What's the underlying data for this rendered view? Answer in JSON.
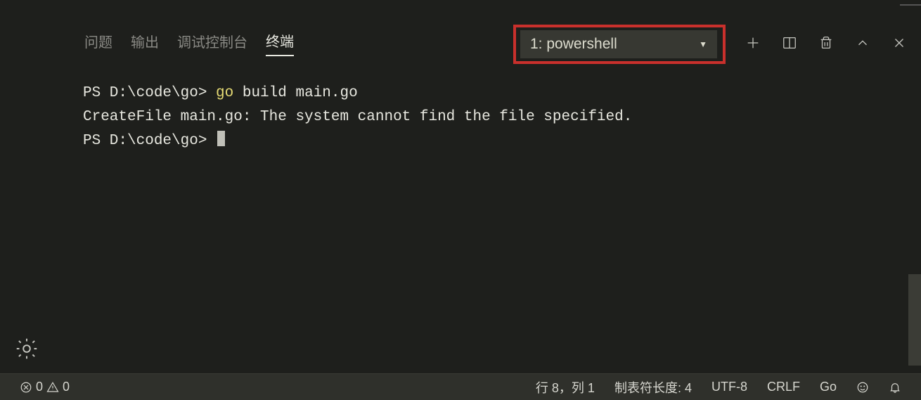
{
  "panel": {
    "tabs": [
      "问题",
      "输出",
      "调试控制台",
      "终端"
    ],
    "active_tab_index": 3,
    "terminal_selector": "1: powershell"
  },
  "terminal": {
    "lines": [
      {
        "prompt": "PS D:\\code\\go> ",
        "cmd_hl": "go",
        "cmd_rest": " build main.go"
      },
      {
        "text": "CreateFile main.go: The system cannot find the file specified."
      },
      {
        "prompt": "PS D:\\code\\go> ",
        "cursor": true
      }
    ]
  },
  "statusbar": {
    "errors": "0",
    "warnings": "0",
    "cursor_pos": "行 8，列 1",
    "tab_size": "制表符长度: 4",
    "encoding": "UTF-8",
    "eol": "CRLF",
    "language": "Go"
  }
}
